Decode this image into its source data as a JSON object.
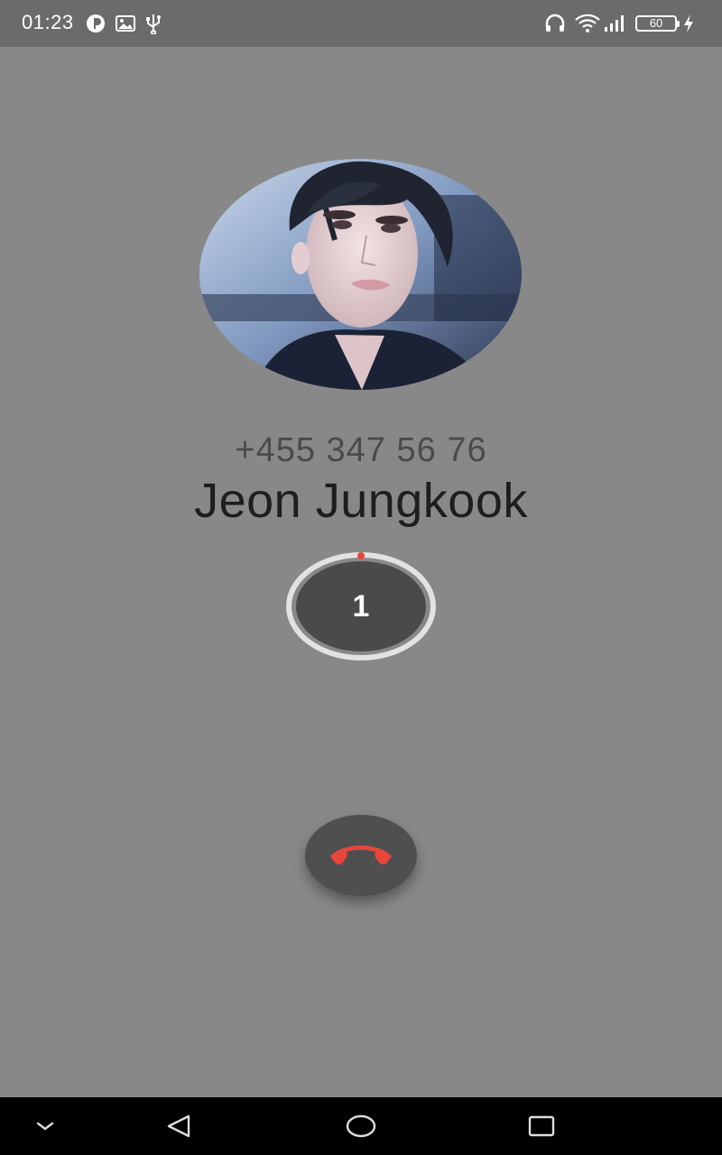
{
  "status_bar": {
    "time": "01:23",
    "battery": "60",
    "icons_left": [
      "pinned-app-icon",
      "gallery-icon",
      "usb-icon"
    ],
    "icons_right": [
      "headphones-icon",
      "wifi-icon",
      "signal-icon",
      "battery-icon",
      "charging-icon"
    ]
  },
  "call": {
    "phone_number": "+455 347 56 76",
    "contact_name": "Jeon Jungkook",
    "timer_count": "1"
  },
  "colors": {
    "background": "#888888",
    "status_bar": "#6b6b6b",
    "end_call_icon": "#e8463a",
    "nav_bar": "#000000"
  },
  "nav_bar": {
    "buttons": [
      "collapse-icon",
      "back-icon",
      "home-icon",
      "recents-icon"
    ]
  }
}
